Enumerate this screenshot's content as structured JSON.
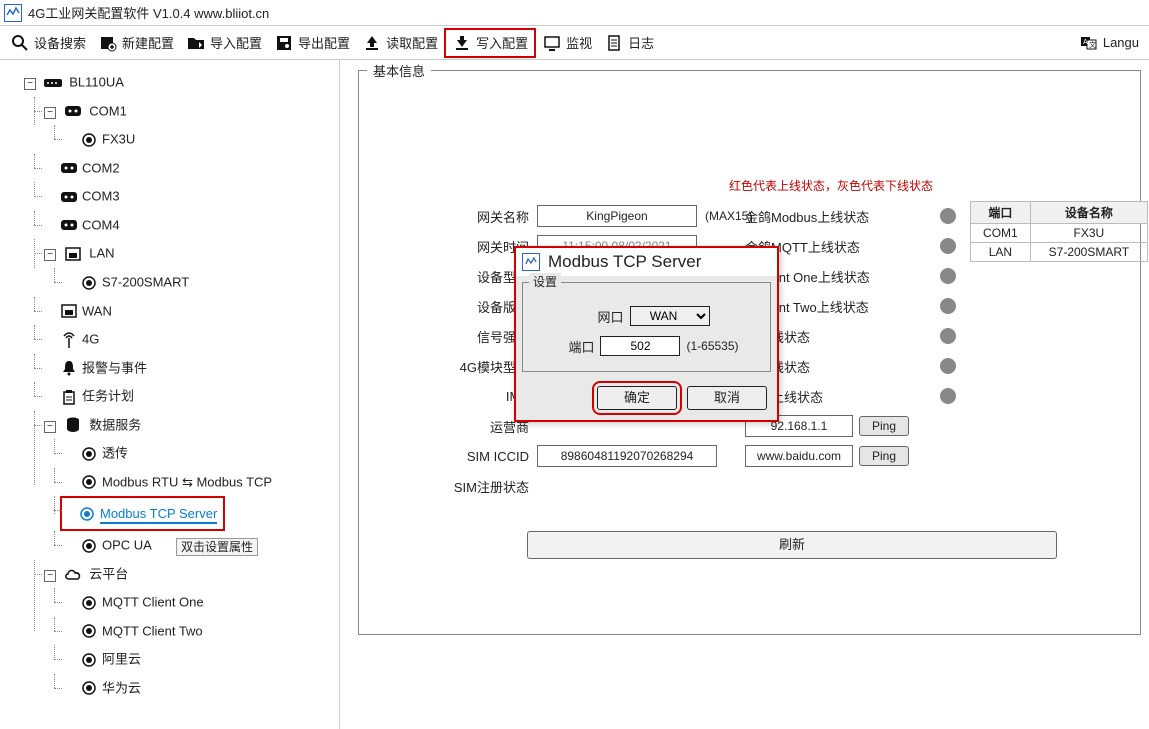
{
  "title": "4G工业网关配置软件 V1.0.4 www.bliiot.cn",
  "toolbar": {
    "search": "设备搜索",
    "new": "新建配置",
    "import": "导入配置",
    "export": "导出配置",
    "read": "读取配置",
    "write": "写入配置",
    "monitor": "监视",
    "log": "日志",
    "lang": "Langu"
  },
  "tree": {
    "root": "BL110UA",
    "com1": "COM1",
    "fx3u": "FX3U",
    "com2": "COM2",
    "com3": "COM3",
    "com4": "COM4",
    "lan": "LAN",
    "s7": "S7-200SMART",
    "wan": "WAN",
    "g4": "4G",
    "alarm": "报警与事件",
    "task": "任务计划",
    "data": "数据服务",
    "passthrough": "透传",
    "rtu_tcp": "Modbus RTU ⇆ Modbus TCP",
    "tcp_server": "Modbus TCP Server",
    "opcua": "OPC UA",
    "cloud": "云平台",
    "mqtt1": "MQTT Client One",
    "mqtt2": "MQTT Client Two",
    "ali": "阿里云",
    "huawei": "华为云",
    "tooltip": "双击设置属性"
  },
  "panel": {
    "title": "基本信息",
    "legend": "红色代表上线状态，灰色代表下线状态",
    "labels": {
      "gw_name": "网关名称",
      "gw_time": "网关时间",
      "dev_model": "设备型号",
      "dev_ver": "设备版本",
      "signal": "信号强度",
      "mod4g": "4G模块型号",
      "imei": "IME",
      "carrier": "运营商",
      "iccid": "SIM ICCID",
      "sim_reg": "SIM注册状态"
    },
    "values": {
      "gw_name": "KingPigeon",
      "gw_name_hint": "(MAX15)",
      "gw_time_placeholder": "11:15:00 08/02/2021",
      "iccid": "89860481192070268294"
    },
    "status": {
      "modbus": "金鸽Modbus上线状态",
      "mqtt": "金鸽MQTT上线状态",
      "c1": "T Client One上线状态",
      "c2": "T Client Two上线状态",
      "s3": "云上线状态",
      "s4": "云上线状态",
      "s5": "巴云上线状态",
      "ip": "92.168.1.1",
      "host": "www.baidu.com",
      "ping": "Ping"
    },
    "refresh": "刷新",
    "table": {
      "h1": "端口",
      "h2": "设备名称",
      "r1c1": "COM1",
      "r1c2": "FX3U",
      "r2c1": "LAN",
      "r2c2": "S7-200SMART"
    }
  },
  "dialog": {
    "title": "Modbus TCP Server",
    "group": "设置",
    "net_label": "网口",
    "net_value": "WAN",
    "port_label": "端口",
    "port_value": "502",
    "port_hint": "(1-65535)",
    "ok": "确定",
    "cancel": "取消"
  }
}
